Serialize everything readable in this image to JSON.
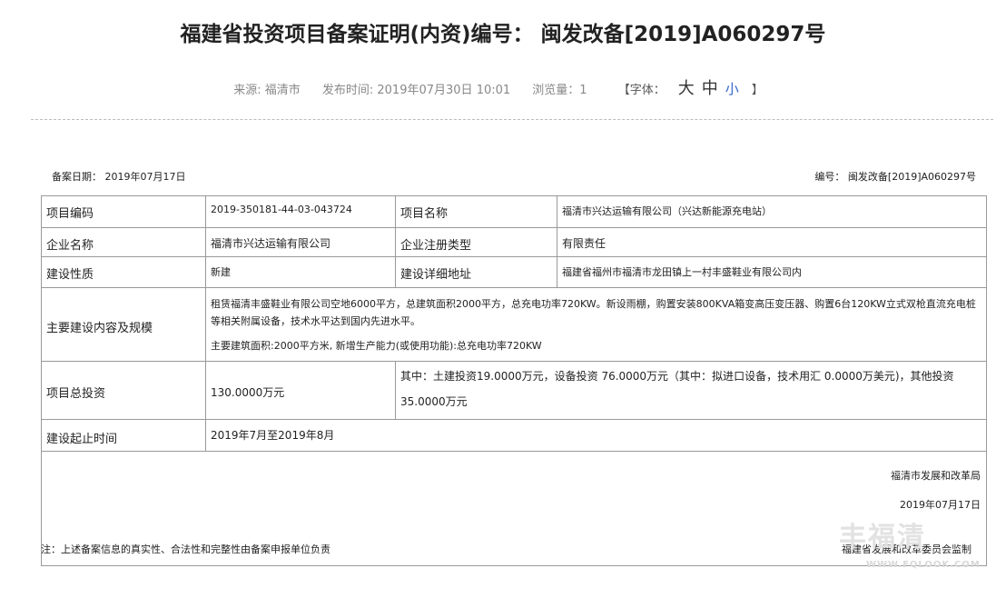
{
  "header": {
    "title": "福建省投资项目备案证明(内资)编号： 闽发改备[2019]A060297号",
    "source": "来源: 福清市",
    "publish_time": "发布时间: 2019年07月30日 10:01",
    "views": "浏览量：1",
    "font_label_open": "【字体：",
    "font_large": "大",
    "font_medium": "中",
    "font_small": "小",
    "font_label_close": "】"
  },
  "record": {
    "date": "备案日期： 2019年07月17日",
    "number": "编号： 闽发改备[2019]A060297号"
  },
  "table": {
    "row1": {
      "label_a": "项目编码",
      "value_a": "2019-350181-44-03-043724",
      "label_b": "项目名称",
      "value_b": "福清市兴达运输有限公司（兴达新能源充电站）"
    },
    "row2": {
      "label_a": "企业名称",
      "value_a": "福清市兴达运输有限公司",
      "label_b": "企业注册类型",
      "value_b": "有限责任"
    },
    "row3": {
      "label_a": "建设性质",
      "value_a": "新建",
      "label_b": "建设详细地址",
      "value_b": "福建省福州市福清市龙田镇上一村丰盛鞋业有限公司内"
    },
    "row4": {
      "label": "主要建设内容及规模",
      "content": "租赁福清丰盛鞋业有限公司空地6000平方，总建筑面积2000平方，总充电功率720KW。新设雨棚，购置安装800KVA箱变高压变压器、购置6台120KW立式双枪直流充电桩等相关附属设备，技术水平达到国内先进水平。",
      "content2": "主要建筑面积:2000平方米, 新增生产能力(或使用功能):总充电功率720KW"
    },
    "row5": {
      "label": "项目总投资",
      "total": "130.0000万元",
      "detail": "其中：土建投资19.0000万元，设备投资 76.0000万元（其中：拟进口设备，技术用汇 0.0000万美元)，其他投资",
      "detail2": "35.0000万元"
    },
    "row6": {
      "label": "建设起止时间",
      "value": "2019年7月至2019年8月"
    },
    "sign": {
      "org": "福清市发展和改革局",
      "date": "2019年07月17日"
    }
  },
  "footer": {
    "note": "注：上述备案信息的真实性、合法性和完整性由备案申报单位负责",
    "right": "福建省发展和改革委员会监制"
  },
  "watermark": {
    "text": "丰福清",
    "url": "WWW.FQLOOK.COM"
  }
}
